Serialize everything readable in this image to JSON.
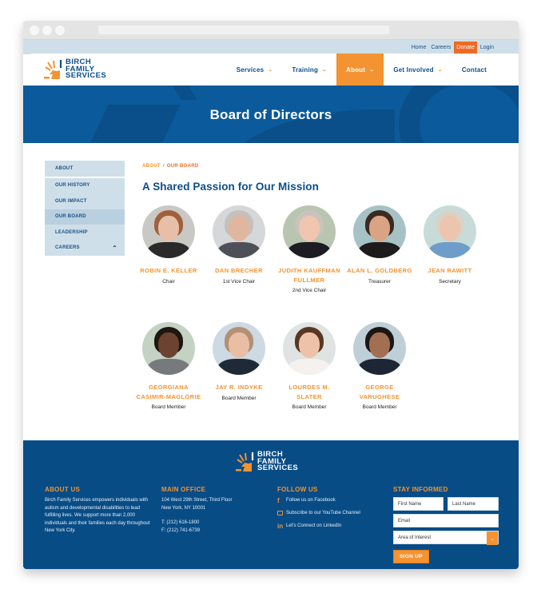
{
  "utility_nav": {
    "items": [
      {
        "label": "Home"
      },
      {
        "label": "Careers"
      },
      {
        "label": "Donate"
      },
      {
        "label": "Login"
      }
    ]
  },
  "brand": {
    "line1": "BIRCH",
    "line2": "FAMILY",
    "line3": "SERVICES",
    "colors": {
      "blue": "#0b4e8a",
      "orange": "#f39331",
      "donate": "#ef6a25"
    }
  },
  "main_nav": {
    "items": [
      {
        "label": "Services",
        "has_dropdown": true
      },
      {
        "label": "Training",
        "has_dropdown": true
      },
      {
        "label": "About",
        "has_dropdown": true,
        "active": true
      },
      {
        "label": "Get Involved",
        "has_dropdown": true
      },
      {
        "label": "Contact",
        "has_dropdown": false
      }
    ],
    "chevron_icon": "chevron-down-icon"
  },
  "hero": {
    "title": "Board of Directors"
  },
  "sidebar": {
    "items": [
      {
        "label": "ABOUT"
      },
      {
        "label": "OUR HISTORY"
      },
      {
        "label": "OUR IMPACT"
      },
      {
        "label": "OUR BOARD",
        "selected": true
      },
      {
        "label": "LEADERSHIP"
      },
      {
        "label": "CAREERS",
        "icon": "chevron-up-icon"
      }
    ]
  },
  "breadcrumb": {
    "parent": "ABOUT",
    "separator": "/",
    "current": "OUR BOARD"
  },
  "section_title": "A Shared Passion for Our Mission",
  "board": {
    "members": [
      {
        "name": "ROBIN E. KELLER",
        "role": "Chair"
      },
      {
        "name": "DAN BRECHER",
        "role": "1st Vice Chair"
      },
      {
        "name": "JUDITH KAUFFMAN FULLMER",
        "role": "2nd Vice Chair"
      },
      {
        "name": "ALAN L. GOLDBERG",
        "role": "Treasurer"
      },
      {
        "name": "JEAN RAWITT",
        "role": "Secretary"
      },
      {
        "name": "GEORGIANA CASIMIR-MAGLORIE",
        "role": "Board Member"
      },
      {
        "name": "JAY R. INDYKE",
        "role": "Board Member"
      },
      {
        "name": "LOURDES M. SLATER",
        "role": "Board Member"
      },
      {
        "name": "GEORGE VARUGHESE",
        "role": "Board Member"
      }
    ]
  },
  "footer": {
    "about": {
      "heading": "ABOUT US",
      "text": "Birch Family Services empowers individuals with autism and developmental disabilities to lead fulfilling lives. We support more than 2,000 individuals and their families each day throughout New York City."
    },
    "office": {
      "heading": "MAIN OFFICE",
      "address1": "104 West 29th Street, Third Floor",
      "address2": "New York, NY 10001",
      "phone": "T: (212) 616-1800",
      "fax": "F: (212) 741-6739"
    },
    "follow": {
      "heading": "FOLLOW US",
      "links": [
        {
          "icon": "facebook-icon",
          "label": "Follow us on Facebook"
        },
        {
          "icon": "youtube-icon",
          "label": "Subscribe to our YouTube Channel"
        },
        {
          "icon": "linkedin-icon",
          "label": "Let's Connect on LinkedIn"
        }
      ]
    },
    "newsletter": {
      "heading": "STAY INFORMED",
      "first_name_placeholder": "First Name",
      "last_name_placeholder": "Last Name",
      "email_placeholder": "Email",
      "interest_selected": "Area of Interest",
      "submit_label": "SIGN UP"
    }
  }
}
